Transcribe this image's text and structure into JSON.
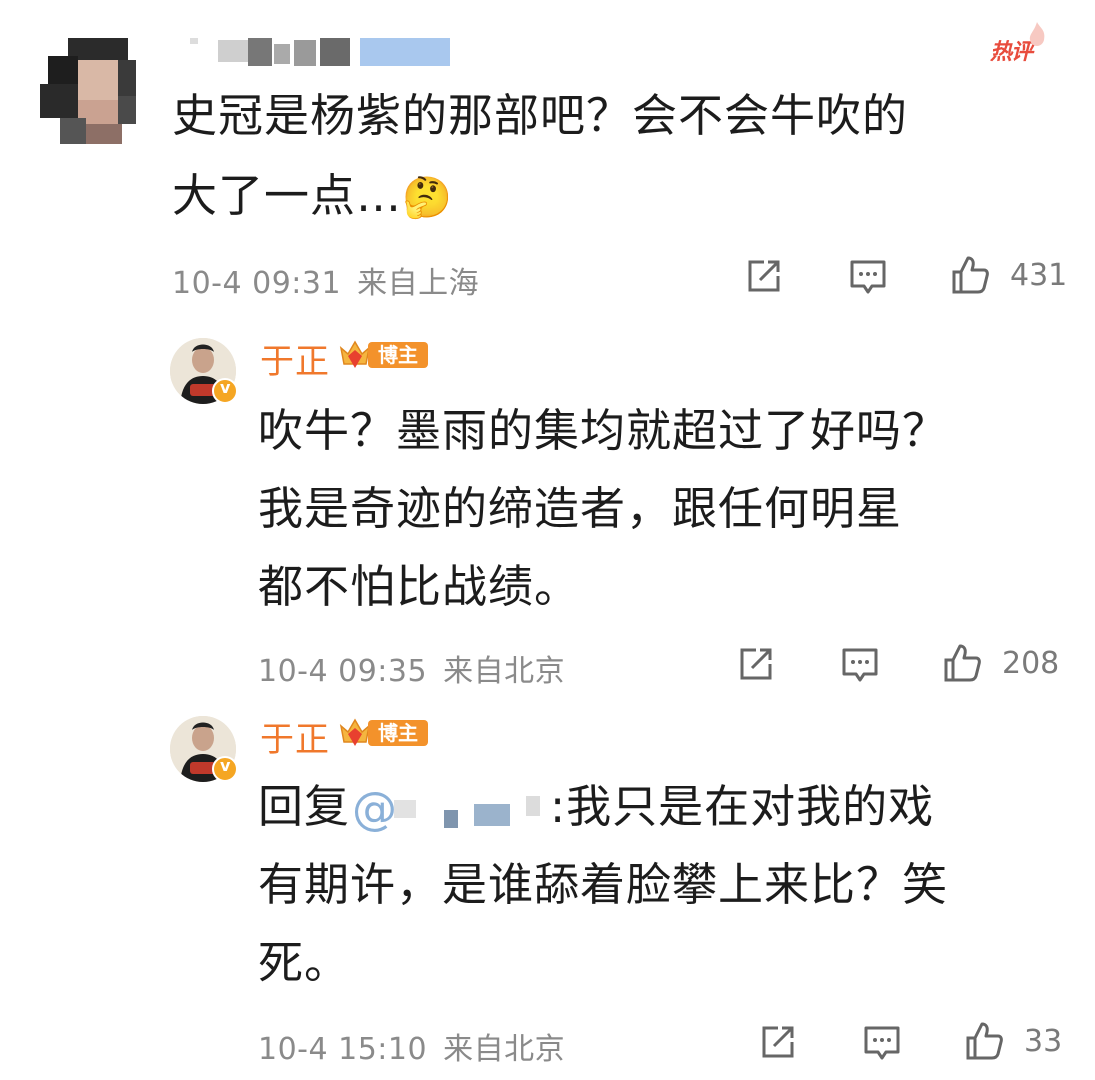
{
  "comment": {
    "hot_label": "热评",
    "text_line1": "史冠是杨紫的那部吧？会不会牛吹的",
    "text_line2": "大了一点…",
    "emoji": "🤔",
    "date": "10-4 09:31",
    "location": "来自上海",
    "likes": "431"
  },
  "replies": [
    {
      "username": "于正",
      "badge_label": "博主",
      "text_line1": "吹牛？墨雨的集均就超过了好吗？",
      "text_line2": "我是奇迹的缔造者，跟任何明星",
      "text_line3": "都不怕比战绩。",
      "date": "10-4 09:35",
      "location": "来自北京",
      "likes": "208"
    },
    {
      "username": "于正",
      "badge_label": "博主",
      "reply_prefix": "回复",
      "mention_start": "@",
      "text_line1_rest": ":我只是在对我的戏",
      "text_line2": "有期许，是谁舔着脸攀上来比？笑",
      "text_line3": "死。",
      "date": "10-4 15:10",
      "location": "来自北京",
      "likes": "33"
    }
  ],
  "icons": [
    "share-icon",
    "comment-icon",
    "like-icon",
    "verified-icon",
    "vip-crown-icon",
    "flame-icon"
  ],
  "colors": {
    "username": "#f0782c",
    "badge": "#f3922b",
    "hot": "#e84c3d",
    "meta": "#8a8a8a"
  }
}
